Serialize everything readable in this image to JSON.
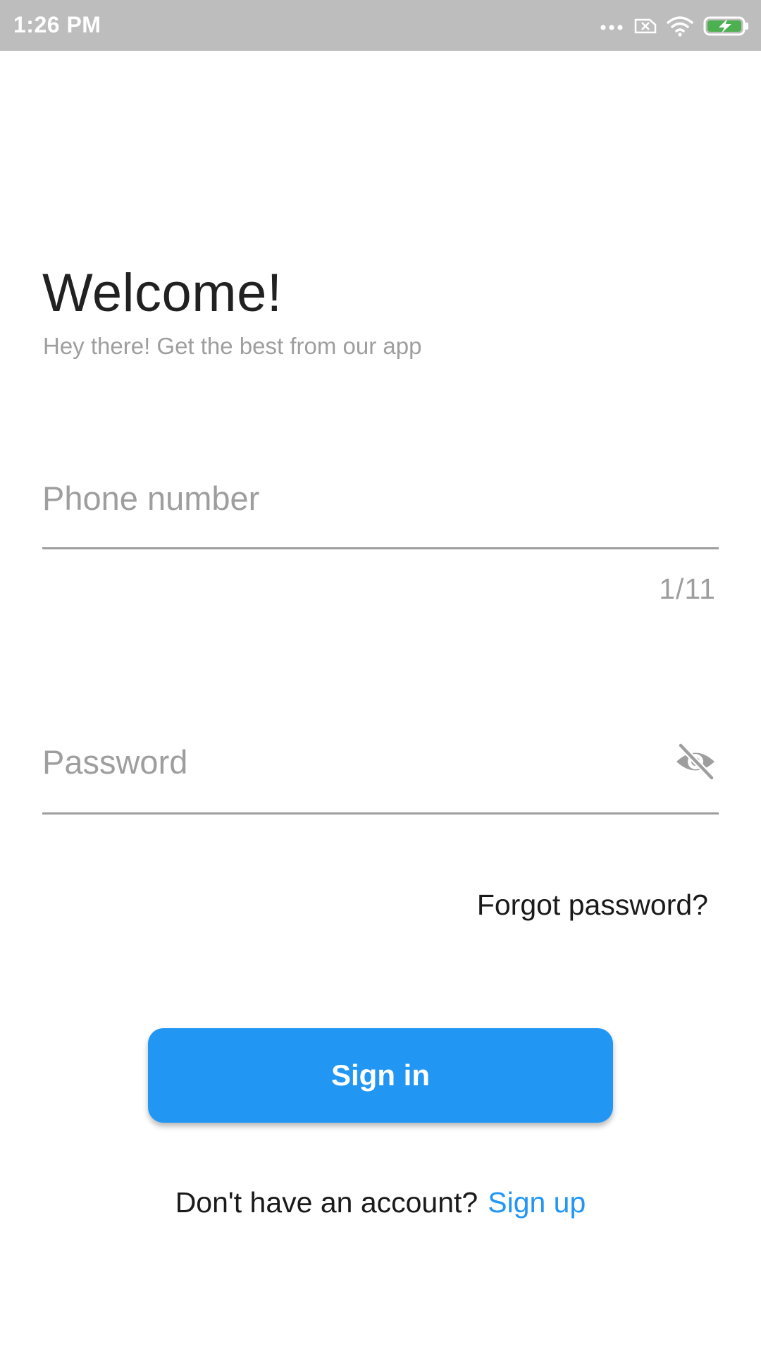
{
  "status_bar": {
    "time": "1:26 PM",
    "icons": [
      "more-dots-icon",
      "sim-disabled-icon",
      "wifi-icon",
      "battery-charging-icon"
    ]
  },
  "header": {
    "title": "Welcome!",
    "subtitle": "Hey there! Get the best from our app"
  },
  "form": {
    "phone": {
      "value": "",
      "placeholder": "Phone number",
      "counter": "1/11"
    },
    "password": {
      "value": "",
      "placeholder": "Password",
      "visibility_icon": "eye-off-icon"
    },
    "forgot_label": "Forgot password?",
    "signin_label": "Sign in"
  },
  "footer": {
    "prompt": "Don't have an account?",
    "signup_label": "Sign up"
  },
  "colors": {
    "status_bar": "#bdbdbd",
    "accent": "#2196f3",
    "hint": "#9e9e9e",
    "battery_green": "#4caf50"
  }
}
